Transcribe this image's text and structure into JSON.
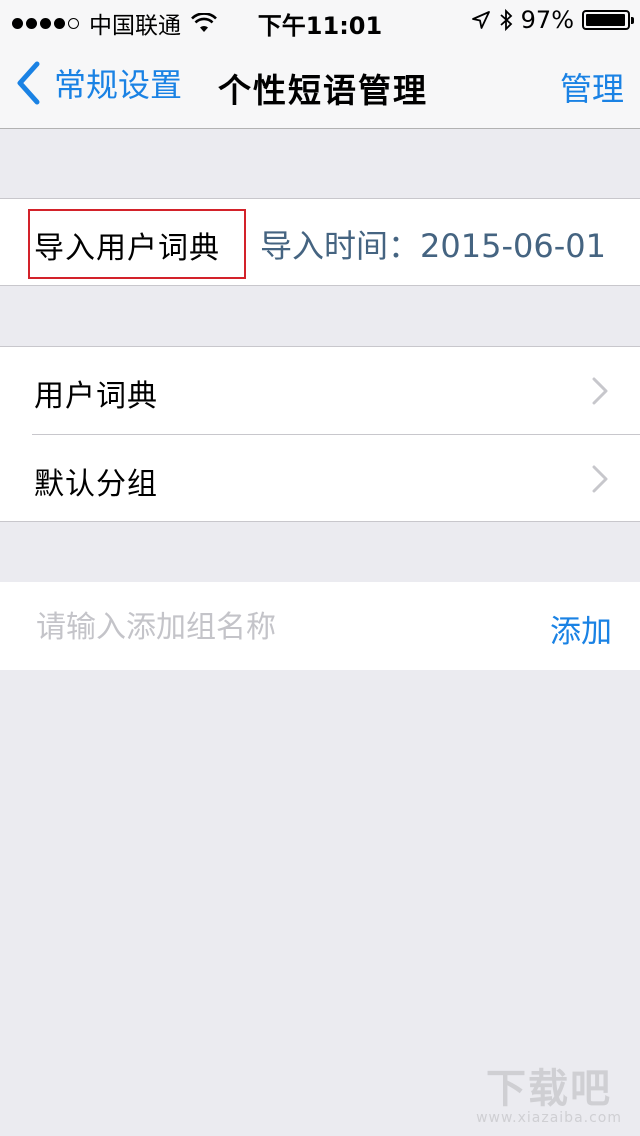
{
  "status_bar": {
    "carrier": "中国联通",
    "time": "下午11:01",
    "battery": "97%",
    "battery_level": 0.97,
    "signal_bars": 4
  },
  "nav": {
    "back_label": "常规设置",
    "title": "个性短语管理",
    "action_label": "管理"
  },
  "import": {
    "label": "导入用户词典",
    "time_label": "导入时间：",
    "time_value": "2015-06-01"
  },
  "list": {
    "items": [
      {
        "label": "用户词典"
      },
      {
        "label": "默认分组"
      }
    ]
  },
  "add_group": {
    "placeholder": "请输入添加组名称",
    "button_label": "添加"
  },
  "watermark": {
    "main": "下载吧",
    "sub": "www.xiazaiba.com"
  },
  "colors": {
    "accent": "#1a82e4",
    "highlight_box": "#d3222a",
    "background": "#ebebf0"
  }
}
